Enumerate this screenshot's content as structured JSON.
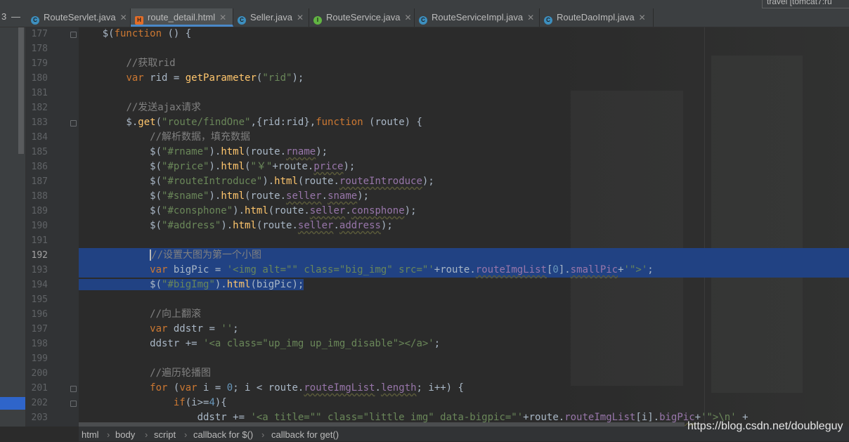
{
  "tabs": [
    {
      "label": "RouteServlet.java",
      "icon": "class-icon",
      "active": false
    },
    {
      "label": "route_detail.html",
      "icon": "html-file-icon",
      "active": true
    },
    {
      "label": "Seller.java",
      "icon": "class-icon",
      "active": false
    },
    {
      "label": "RouteService.java",
      "icon": "interface-icon",
      "active": false
    },
    {
      "label": "RouteServiceImpl.java",
      "icon": "class-icon",
      "active": false
    },
    {
      "label": "RouteDaoImpl.java",
      "icon": "class-icon",
      "active": false
    }
  ],
  "run_config": "travel [tomcat7:ru",
  "line_numbers": [
    "177",
    "178",
    "179",
    "180",
    "181",
    "182",
    "183",
    "184",
    "185",
    "186",
    "187",
    "188",
    "189",
    "190",
    "191",
    "192",
    "193",
    "194",
    "195",
    "196",
    "197",
    "198",
    "199",
    "200",
    "201",
    "202",
    "203"
  ],
  "current_line": "192",
  "code_lines": [
    "$(function () {",
    "",
    "    //获取rid",
    "    var rid = getParameter(\"rid\");",
    "",
    "    //发送ajax请求",
    "    $.get(\"route/findOne\",{rid:rid},function (route) {",
    "        //解析数据，填充数据",
    "        $(\"#rname\").html(route.rname);",
    "        $(\"#price\").html(\"￥\"+route.price);",
    "        $(\"#routeIntroduce\").html(route.routeIntroduce);",
    "        $(\"#sname\").html(route.seller.sname);",
    "        $(\"#consphone\").html(route.seller.consphone);",
    "        $(\"#address\").html(route.seller.address);",
    "",
    "        //设置大图为第一个小图",
    "        var bigPic = '<img alt=\"\" class=\"big_img\" src=\"'+route.routeImgList[0].smallPic+'\">';",
    "        $(\"#bigImg\").html(bigPic);",
    "",
    "        //向上翻滚",
    "        var ddstr = '';",
    "        ddstr += '<a class=\"up_img up_img_disable\"></a>';",
    "",
    "        //遍历轮播图",
    "        for (var i = 0; i < route.routeImgList.length; i++) {",
    "            if(i>=4){",
    "                ddstr += '<a title=\"\" class=\"little_img\" data-bigpic=\"'+route.routeImgList[i].bigPic+'\">\\n' +"
  ],
  "breadcrumbs": [
    "html",
    "body",
    "script",
    "callback for $()",
    "callback for get()"
  ],
  "watermark": "https://blog.csdn.net/doubleguy",
  "colors": {
    "keyword": "#cc7832",
    "string": "#6a8759",
    "comment": "#808080",
    "function": "#ffc66d",
    "property": "#9876aa",
    "number": "#6897bb",
    "selection": "#214283",
    "background": "#2b2b2b"
  }
}
